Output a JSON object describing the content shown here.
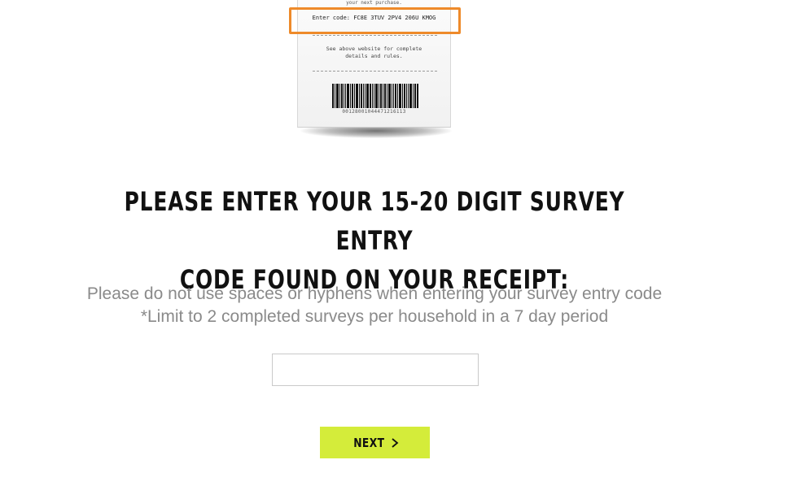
{
  "receipt": {
    "top_text": "your next purchase.",
    "code_line": "Enter code: FC8E 3TUV 2PV4 206U KMOG",
    "note_line1": "See above website for complete",
    "note_line2": "details and rules.",
    "barcode_number": "00128001044471216113"
  },
  "highlight": {
    "color": "#ee8a2a"
  },
  "heading": {
    "line1": "PLEASE ENTER YOUR 15-20 DIGIT SURVEY ENTRY",
    "line2": "CODE FOUND ON YOUR RECEIPT:"
  },
  "instructions": {
    "line1": "Please do not use spaces or hyphens when entering your survey entry code",
    "line2": "*Limit to 2 completed surveys per household in a 7 day period"
  },
  "code_input": {
    "value": "",
    "placeholder": ""
  },
  "next_button": {
    "label": "NEXT",
    "icon": "chevron-right-icon",
    "color": "#d4ec3a"
  }
}
